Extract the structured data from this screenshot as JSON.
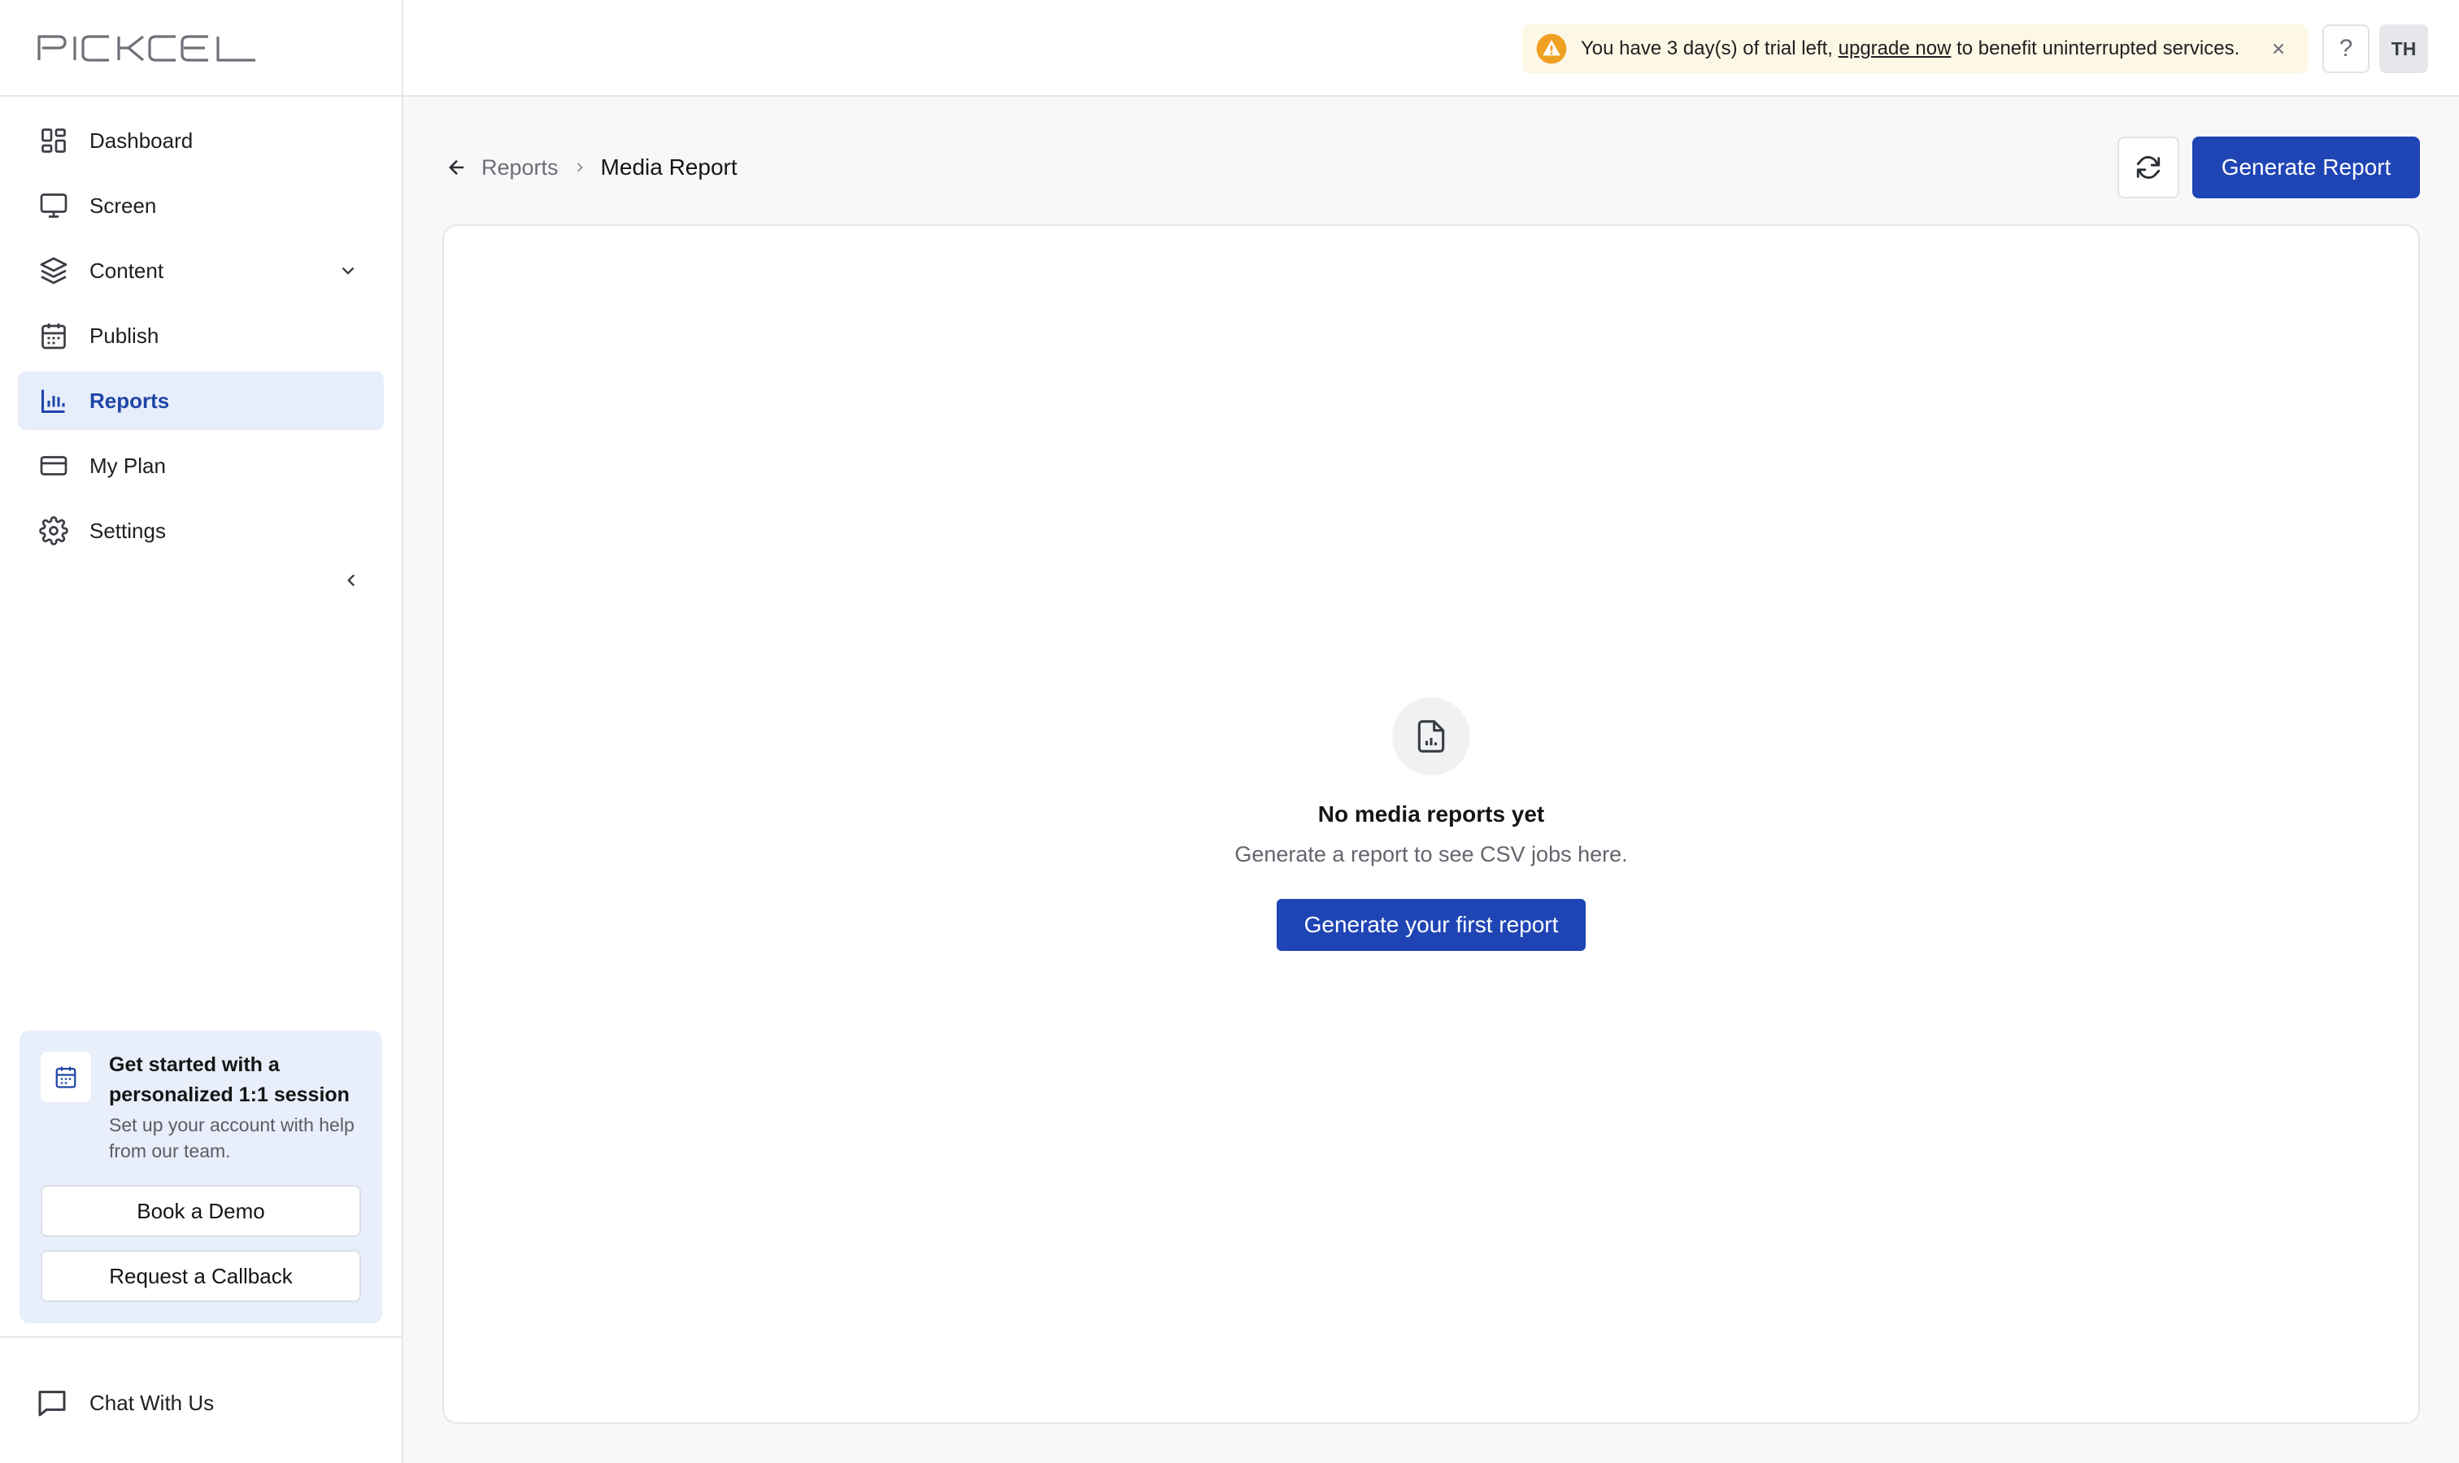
{
  "app": {
    "logo_text": "PICKCEL"
  },
  "sidebar": {
    "items": [
      {
        "label": "Dashboard",
        "icon": "dashboard-icon"
      },
      {
        "label": "Screen",
        "icon": "monitor-icon"
      },
      {
        "label": "Content",
        "icon": "layers-icon",
        "has_submenu": true
      },
      {
        "label": "Publish",
        "icon": "calendar-icon"
      },
      {
        "label": "Reports",
        "icon": "bar-chart-icon",
        "active": true
      },
      {
        "label": "My Plan",
        "icon": "credit-card-icon"
      },
      {
        "label": "Settings",
        "icon": "gear-icon"
      }
    ],
    "promo": {
      "title": "Get started with a personalized 1:1 session",
      "description": "Set up your account with help from our team.",
      "book_demo_label": "Book a Demo",
      "callback_label": "Request a Callback"
    },
    "chat_label": "Chat With Us"
  },
  "topbar": {
    "trial": {
      "prefix": "You have 3 day(s) of trial left, ",
      "link": "upgrade now",
      "suffix": " to benefit uninterrupted services."
    },
    "help_label": "?",
    "avatar_initials": "TH"
  },
  "main": {
    "breadcrumb": {
      "parent": "Reports",
      "current": "Media Report"
    },
    "generate_button_label": "Generate Report",
    "empty_state": {
      "title": "No media reports yet",
      "description": "Generate a report to see CSV jobs here.",
      "button_label": "Generate your first report"
    }
  },
  "colors": {
    "primary": "#1f45b5",
    "active_nav_bg": "#e7eefb",
    "active_nav_text": "#1f45a8",
    "warning": "#f0a020",
    "banner_bg": "#fdf7e6",
    "promo_bg": "#e8eefa"
  }
}
